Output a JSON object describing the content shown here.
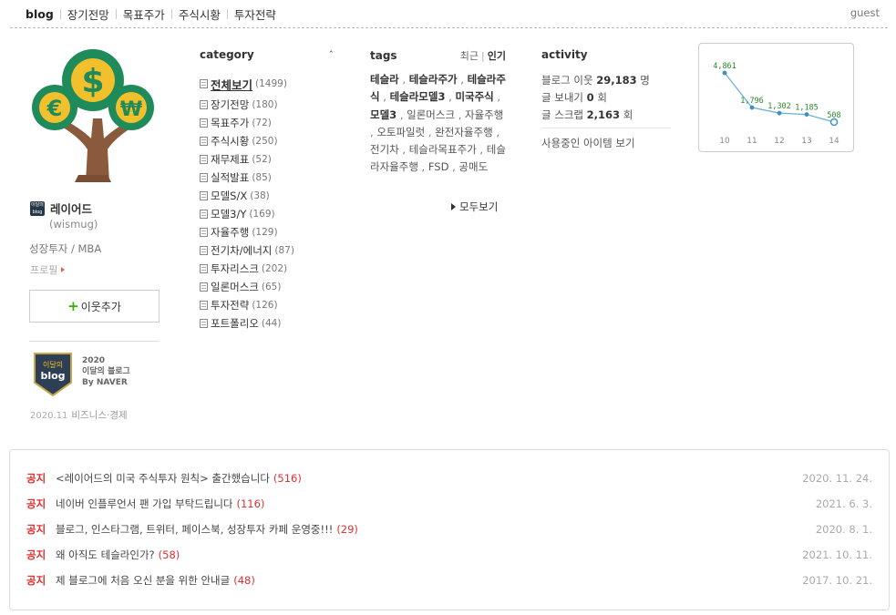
{
  "nav": {
    "items": [
      "blog",
      "장기전망",
      "목표주가",
      "주식시황",
      "투자전략"
    ],
    "guest": "guest"
  },
  "profile": {
    "nickname": "레이어드",
    "user_id": "(wismug)",
    "description": "성장투자 / MBA",
    "profile_link": "프로필",
    "add_neighbor": "이웃추가",
    "badge": {
      "year": "2020",
      "title": "이달의 블로그",
      "by": "By NAVER",
      "date": "2020.11",
      "category": "비즈니스·경제",
      "emblem_line1": "이달의",
      "emblem_line2": "blog"
    }
  },
  "category": {
    "title": "category",
    "toggle": "ˆ",
    "items": [
      {
        "label": "전체보기",
        "count": "(1499)"
      },
      {
        "label": "장기전망",
        "count": "(180)"
      },
      {
        "label": "목표주가",
        "count": "(72)"
      },
      {
        "label": "주식시황",
        "count": "(250)"
      },
      {
        "label": "재무제표",
        "count": "(52)"
      },
      {
        "label": "실적발표",
        "count": "(85)"
      },
      {
        "label": "모델S/X",
        "count": "(38)"
      },
      {
        "label": "모델3/Y",
        "count": "(169)"
      },
      {
        "label": "자율주행",
        "count": "(129)"
      },
      {
        "label": "전기차/에너지",
        "count": "(87)"
      },
      {
        "label": "투자리스크",
        "count": "(202)"
      },
      {
        "label": "일론머스크",
        "count": "(65)"
      },
      {
        "label": "투자전략",
        "count": "(126)"
      },
      {
        "label": "포트폴리오",
        "count": "(44)"
      }
    ]
  },
  "tags": {
    "title": "tags",
    "sort_recent": "최근",
    "sort_popular": "인기",
    "items": [
      {
        "label": "테슬라",
        "bold": true
      },
      {
        "label": "테슬라주가",
        "bold": true
      },
      {
        "label": "테슬라주식",
        "bold": true
      },
      {
        "label": "테슬라모델3",
        "bold": true
      },
      {
        "label": "미국주식",
        "bold": true
      },
      {
        "label": "모델3",
        "bold": true
      },
      {
        "label": "일론머스크",
        "bold": false
      },
      {
        "label": "자율주행",
        "bold": false
      },
      {
        "label": "오토파일럿",
        "bold": false
      },
      {
        "label": "완전자율주행",
        "bold": false
      },
      {
        "label": "전기차",
        "bold": false
      },
      {
        "label": "테슬라목표주가",
        "bold": false
      },
      {
        "label": "테슬라자율주행",
        "bold": false
      },
      {
        "label": "FSD",
        "bold": false
      },
      {
        "label": "공매도",
        "bold": false
      }
    ],
    "more": "모두보기"
  },
  "activity": {
    "title": "activity",
    "neighbors_label": "블로그 이웃",
    "neighbors_value": "29,183",
    "neighbors_unit": "명",
    "sends_label": "글 보내기",
    "sends_value": "0",
    "sends_unit": "회",
    "scraps_label": "글 스크랩",
    "scraps_value": "2,163",
    "scraps_unit": "회",
    "items_link": "사용중인 아이템 보기"
  },
  "chart_data": {
    "type": "line",
    "x": [
      "10",
      "11",
      "12",
      "13",
      "14"
    ],
    "values": [
      4861,
      1796,
      1302,
      1185,
      508
    ],
    "value_labels": [
      "4,861",
      "1,796",
      "1,302",
      "1,185",
      "508"
    ],
    "title": "",
    "xlabel": "",
    "ylabel": "",
    "grid": false,
    "colors": {
      "line": "#6aaed6",
      "point": "#3d8fc4",
      "label": "#2a8a2a",
      "last_point_fill": "#ffffff"
    }
  },
  "notices": [
    {
      "tag": "공지",
      "title": "<레이어드의 미국 주식투자 원칙> 출간했습니다",
      "count": "(516)",
      "date": "2020. 11. 24."
    },
    {
      "tag": "공지",
      "title": "네이버 인플루언서 팬 가입 부탁드립니다",
      "count": "(116)",
      "date": "2021. 6. 3."
    },
    {
      "tag": "공지",
      "title": "블로그, 인스타그램, 트위터, 페이스북, 성장투자 카페 운영중!!!",
      "count": "(29)",
      "date": "2020. 8. 1."
    },
    {
      "tag": "공지",
      "title": "왜 아직도 테슬라인가?",
      "count": "(58)",
      "date": "2021. 10. 11."
    },
    {
      "tag": "공지",
      "title": "제 블로그에 처음 오신 분을 위한 안내글",
      "count": "(48)",
      "date": "2017. 10. 21."
    }
  ],
  "colors": {
    "accent_green": "#2db400",
    "notice_red": "#e03030",
    "tree_green": "#1f8a5a",
    "coin_gold": "#f2c02c",
    "trunk": "#8b5a3c"
  },
  "icons": {
    "logo": "money-tree-icon",
    "add": "plus-icon",
    "doc": "document-icon",
    "more": "triangle-right-icon"
  }
}
